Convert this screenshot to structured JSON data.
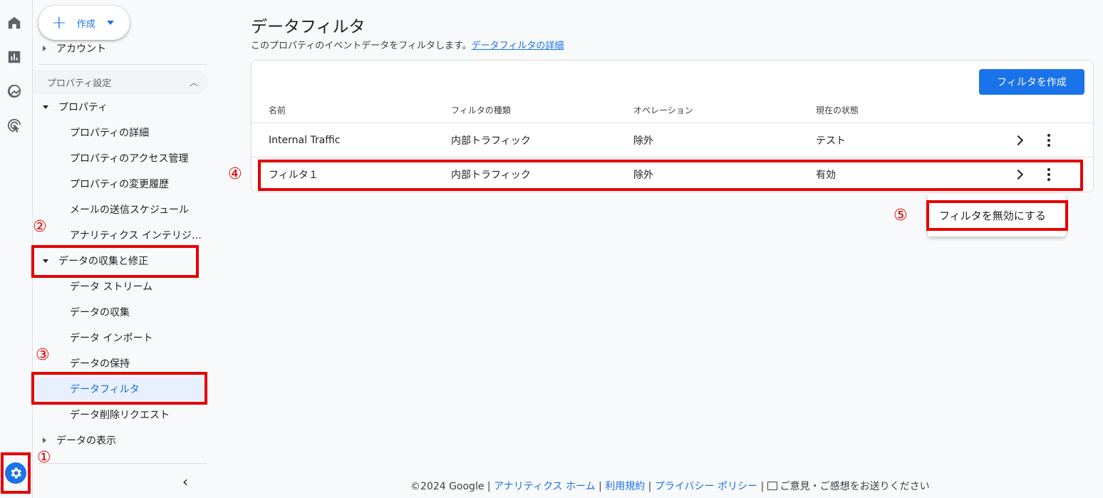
{
  "rail": {
    "icons": [
      "home-icon",
      "reports-icon",
      "explore-icon",
      "advertising-icon"
    ],
    "settings_icon": "gear-icon"
  },
  "nav": {
    "create_label": "作成",
    "account_label": "アカウント",
    "section_label": "プロパティ設定",
    "property_label": "プロパティ",
    "property_items": [
      "プロパティの詳細",
      "プロパティのアクセス管理",
      "プロパティの変更履歴",
      "メールの送信スケジュール",
      "アナリティクス インテリジ…"
    ],
    "data_collection_label": "データの収集と修正",
    "data_items": [
      "データ ストリーム",
      "データの収集",
      "データ インポート",
      "データの保持",
      "データフィルタ",
      "データ削除リクエスト"
    ],
    "data_display_label": "データの表示"
  },
  "annotations": {
    "n1": "①",
    "n2": "②",
    "n3": "③",
    "n4": "④",
    "n5": "⑤",
    "color": "#e60000"
  },
  "main": {
    "title": "データフィルタ",
    "subtitle": "このプロパティのイベントデータをフィルタします。",
    "subtitle_link": "データフィルタの詳細",
    "create_filter_button": "フィルタを作成",
    "columns": [
      "名前",
      "フィルタの種類",
      "オペレーション",
      "現在の状態"
    ],
    "rows": [
      {
        "name": "Internal Traffic",
        "type": "内部トラフィック",
        "operation": "除外",
        "status": "テスト"
      },
      {
        "name": "フィルタ１",
        "type": "内部トラフィック",
        "operation": "除外",
        "status": "有効"
      }
    ],
    "menu_item": "フィルタを無効にする",
    "accent_color": "#1a73e8"
  },
  "footer": {
    "copyright": "©2024 Google",
    "sep": "|",
    "links": [
      "アナリティクス ホーム",
      "利用規約",
      "プライバシー ポリシー"
    ],
    "feedback": "ご意見・ご感想をお送りください"
  }
}
